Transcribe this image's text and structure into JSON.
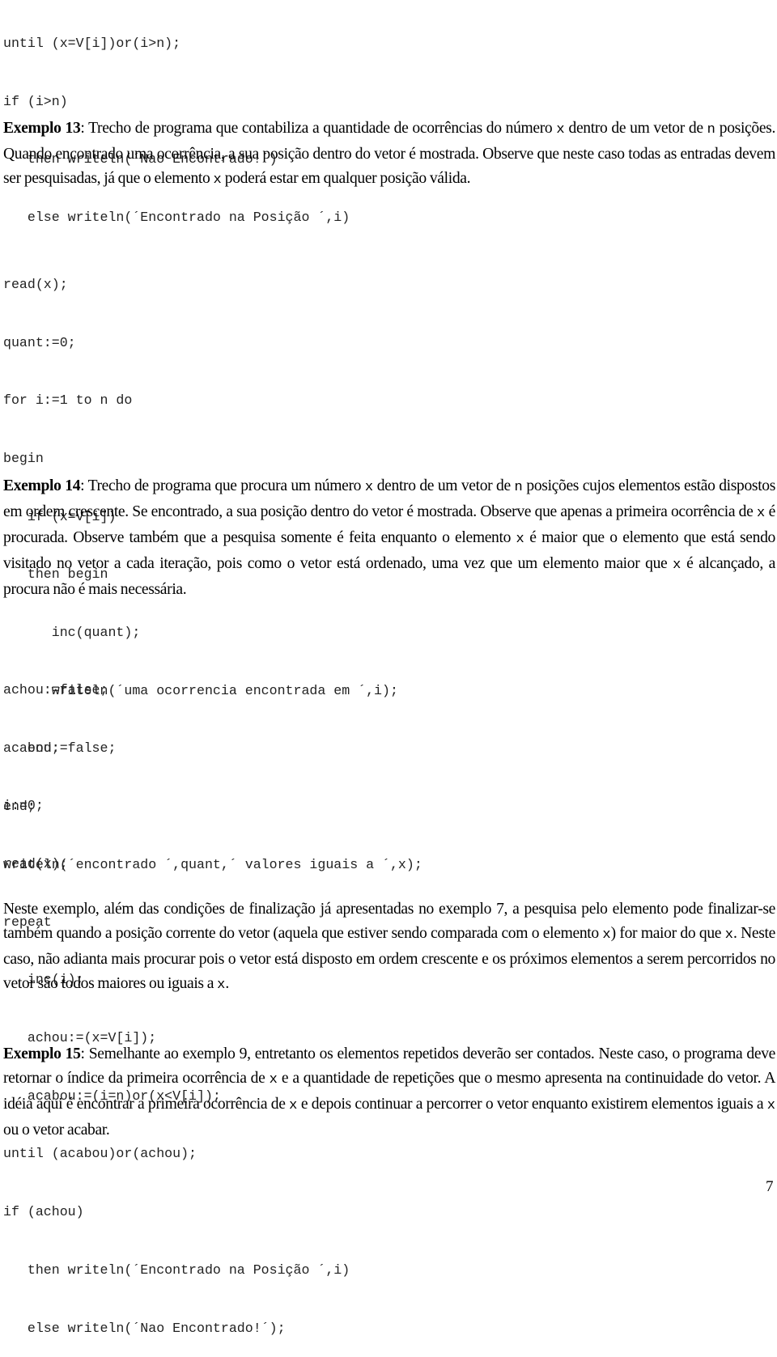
{
  "code_top": [
    "until (x=V[i])or(i>n);",
    "if (i>n)",
    "   then writeln(´Nao Encontrado!´)",
    "   else writeln(´Encontrado na Posição ´,i)"
  ],
  "example13": {
    "label": "Exemplo 13",
    "t1": ": Trecho de programa que contabiliza a quantidade de ocorrências do número ",
    "x": "x",
    "t2": " dentro de um vetor de ",
    "n": "n",
    "t3": " posições. Quando encontrado uma ocorrência, a sua posição dentro do vetor é mostrada. Observe que neste caso todas as entradas devem ser pesquisadas, já que o elemento ",
    "x2": "x",
    "t4": " poderá estar em qualquer posição válida."
  },
  "code_example13": [
    "read(x);",
    "quant:=0;",
    "for i:=1 to n do",
    "begin",
    "   if (x=V[i])",
    "   then begin",
    "      inc(quant);",
    "      writeln(´uma ocorrencia encontrada em ´,i);",
    "   end;",
    "end;",
    "writeln(´encontrado ´,quant,´ valores iguais a ´,x);"
  ],
  "example14": {
    "label": "Exemplo 14",
    "t1": ": Trecho de programa que procura um número ",
    "x": "x",
    "t2": " dentro de um vetor de ",
    "n": "n",
    "t3": " posições cujos elementos estão dispostos em ordem crescente. Se encontrado, a sua posição dentro do vetor é mostrada. Observe que apenas a primeira ocorrência de ",
    "x2": "x",
    "t4": " é procurada. Observe também que a pesquisa somente é feita enquanto o elemento ",
    "x3": "x",
    "t5": " é maior que o elemento que está sendo visitado no vetor a cada iteração, pois como o vetor está ordenado, uma vez que um elemento maior que ",
    "x4": "x",
    "t6": " é alcançado, a procura não é mais necessária."
  },
  "code_example14": [
    "achou:=false;",
    "acabou:=false;",
    "i:=0;",
    "read(x);",
    "repeat",
    "   inc(i);",
    "   achou:=(x=V[i]);",
    "   acabou:=(i=n)or(x<V[i]);",
    "until (acabou)or(achou);",
    "if (achou)",
    "   then writeln(´Encontrado na Posição ´,i)",
    "   else writeln(´Nao Encontrado!´);"
  ],
  "explanation": {
    "t1": "Neste exemplo, além das condições de finalização já apresentadas no exemplo 7, a pesquisa pelo elemento pode finalizar-se também quando a posição corrente do vetor (aquela que estiver sendo comparada com o elemento ",
    "x": "x",
    "t2": ") for maior do que ",
    "x2": "x",
    "t3": ". Neste caso, não adianta mais procurar pois o vetor está disposto em ordem crescente e os próximos elementos a serem percorridos no vetor são todos maiores ou iguais a ",
    "x3": "x",
    "t4": "."
  },
  "example15": {
    "label": "Exemplo 15",
    "t1": ": Semelhante ao exemplo 9, entretanto os elementos repetidos deverão ser contados. Neste caso, o programa deve retornar o índice da primeira ocorrência de ",
    "x": "x",
    "t2": " e a quantidade de repetições que o mesmo apresenta na continuidade do vetor. A idéia aqui é encontrar a primeira ocorrência de ",
    "x2": "x",
    "t3": " e depois continuar a percorrer o vetor enquanto existirem elementos iguais a ",
    "x3": "x",
    "t4": " ou o vetor acabar."
  },
  "page_number": "7"
}
